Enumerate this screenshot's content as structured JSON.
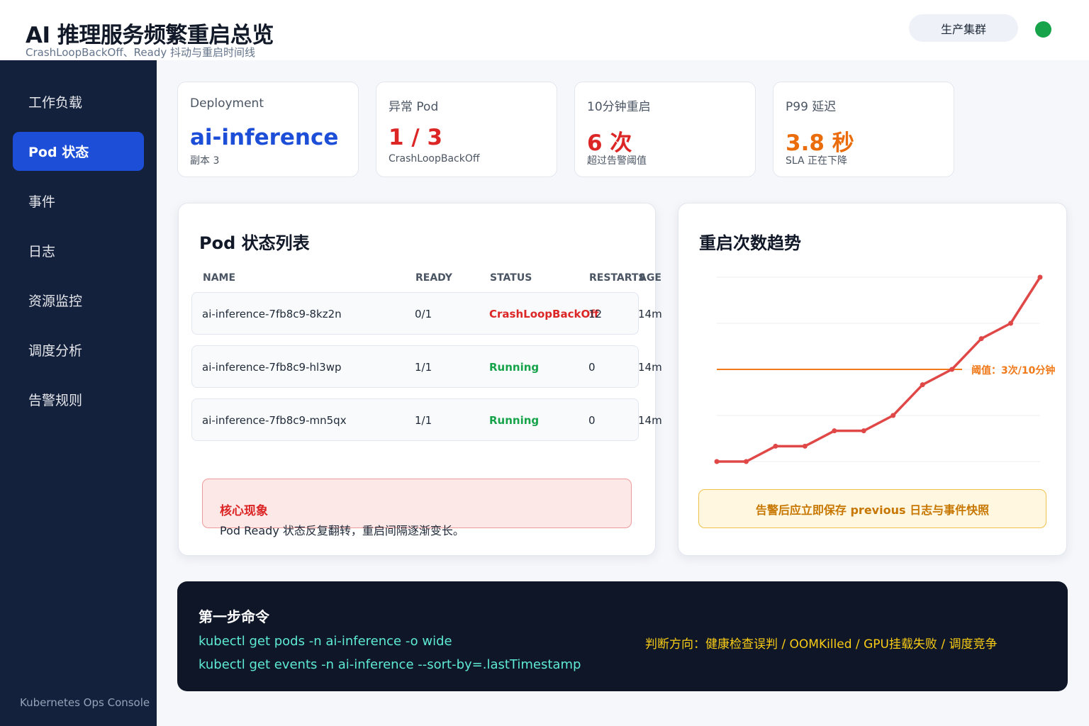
{
  "header": {
    "title": "AI 推理服务频繁重启总览",
    "subtitle": "CrashLoopBackOff、Ready 抖动与重启时间线",
    "cluster_label": "生产集群",
    "status_color": "#16a34a"
  },
  "sidebar": {
    "items": [
      {
        "label": "工作负载",
        "active": false
      },
      {
        "label": "Pod 状态",
        "active": true
      },
      {
        "label": "事件",
        "active": false
      },
      {
        "label": "日志",
        "active": false
      },
      {
        "label": "资源监控",
        "active": false
      },
      {
        "label": "调度分析",
        "active": false
      },
      {
        "label": "告警规则",
        "active": false
      }
    ],
    "footer": "Kubernetes Ops Console"
  },
  "stats": [
    {
      "label": "Deployment",
      "value": "ai-inference",
      "sub": "副本 3",
      "color": "#1d4ed8"
    },
    {
      "label": "异常 Pod",
      "value": "1 / 3",
      "sub": "CrashLoopBackOff",
      "color": "#dc2626"
    },
    {
      "label": "10分钟重启",
      "value": "6 次",
      "sub": "超过告警阈值",
      "color": "#dc2626"
    },
    {
      "label": "P99 延迟",
      "value": "3.8 秒",
      "sub": "SLA 正在下降",
      "color": "#ea6c0a"
    }
  ],
  "pod_table": {
    "title": "Pod 状态列表",
    "headers": [
      "NAME",
      "READY",
      "STATUS",
      "RESTARTS",
      "AGE"
    ],
    "rows": [
      {
        "name": "ai-inference-7fb8c9-8kz2n",
        "ready": "0/1",
        "status": "CrashLoopBackOff",
        "restarts": "12",
        "age": "14m",
        "status_color": "#dc2626"
      },
      {
        "name": "ai-inference-7fb8c9-hl3wp",
        "ready": "1/1",
        "status": "Running",
        "restarts": "0",
        "age": "14m",
        "status_color": "#16a34a"
      },
      {
        "name": "ai-inference-7fb8c9-mn5qx",
        "ready": "1/1",
        "status": "Running",
        "restarts": "0",
        "age": "14m",
        "status_color": "#16a34a"
      }
    ]
  },
  "finding": {
    "title": "核心现象",
    "text": "Pod Ready 状态反复翻转，重启间隔逐渐变长。"
  },
  "trend": {
    "title": "重启次数趋势",
    "threshold_label": "阈值：3次/10分钟",
    "warning": "告警后应立即保存 previous 日志与事件快照",
    "line_color": "#e04848",
    "threshold_color": "#f07a1a"
  },
  "chart_data": {
    "type": "line",
    "title": "重启次数趋势",
    "x": [
      0,
      1,
      2,
      3,
      4,
      5,
      6,
      7,
      8,
      9,
      10,
      11
    ],
    "series": [
      {
        "values": [
          0,
          0,
          0.5,
          0.5,
          1,
          1,
          1.5,
          2.5,
          3,
          4,
          4.5,
          6
        ]
      }
    ],
    "threshold": 3,
    "ylim": [
      0,
      6
    ],
    "grid": true,
    "xlabel": "",
    "ylabel": ""
  },
  "commands": {
    "title": "第一步命令",
    "lines": [
      "kubectl get pods -n ai-inference -o wide",
      "kubectl get events -n ai-inference --sort-by=.lastTimestamp"
    ],
    "hint": "判断方向：健康检查误判 / OOMKilled / GPU挂载失败 / 调度竞争"
  }
}
